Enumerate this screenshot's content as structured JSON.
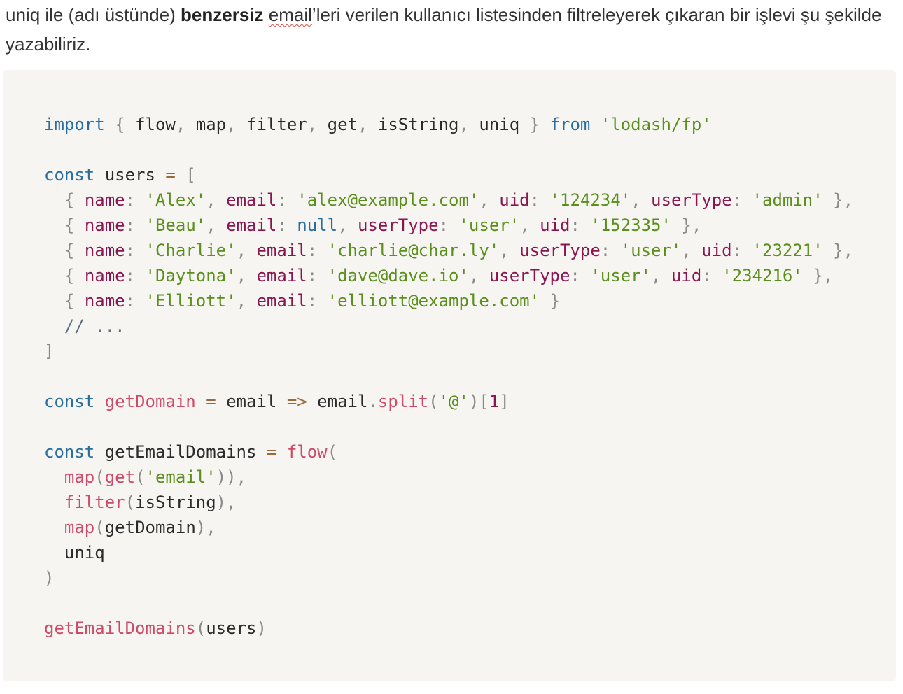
{
  "intro": {
    "part1": "uniq ile (adı üstünde) ",
    "bold": "benzersiz",
    "part2": " ",
    "underlined": "email",
    "part3": "’leri verilen kullanıcı listesinden filtreleyerek çıkaran bir işlevi şu şekilde yazabiliriz."
  },
  "code": {
    "import_kw": "import",
    "import_names": [
      "flow",
      "map",
      "filter",
      "get",
      "isString",
      "uniq"
    ],
    "from_kw": "from",
    "module": "'lodash/fp'",
    "const_kw": "const",
    "users_var": "users",
    "keys": {
      "name": "name",
      "email": "email",
      "uid": "uid",
      "userType": "userType"
    },
    "null_kw": "null",
    "users": [
      {
        "name": "'Alex'",
        "email": "'alex@example.com'",
        "uid": "'124234'",
        "userType": "'admin'"
      },
      {
        "name": "'Beau'",
        "userType": "'user'",
        "uid": "'152335'"
      },
      {
        "name": "'Charlie'",
        "email": "'charlie@char.ly'",
        "userType": "'user'",
        "uid": "'23221'"
      },
      {
        "name": "'Daytona'",
        "email": "'dave@dave.io'",
        "userType": "'user'",
        "uid": "'234216'"
      },
      {
        "name": "'Elliott'",
        "email": "'elliott@example.com'"
      }
    ],
    "comment": "// ...",
    "getDomain_fn": "getDomain",
    "email_param": "email",
    "split_fn": "split",
    "at_str": "'@'",
    "index": "1",
    "getEmailDomains_var": "getEmailDomains",
    "flow_fn": "flow",
    "map_fn": "map",
    "get_fn": "get",
    "email_str": "'email'",
    "filter_fn": "filter",
    "isString_id": "isString",
    "getDomain_id": "getDomain",
    "uniq_id": "uniq",
    "call_fn": "getEmailDomains",
    "call_arg": "users"
  }
}
